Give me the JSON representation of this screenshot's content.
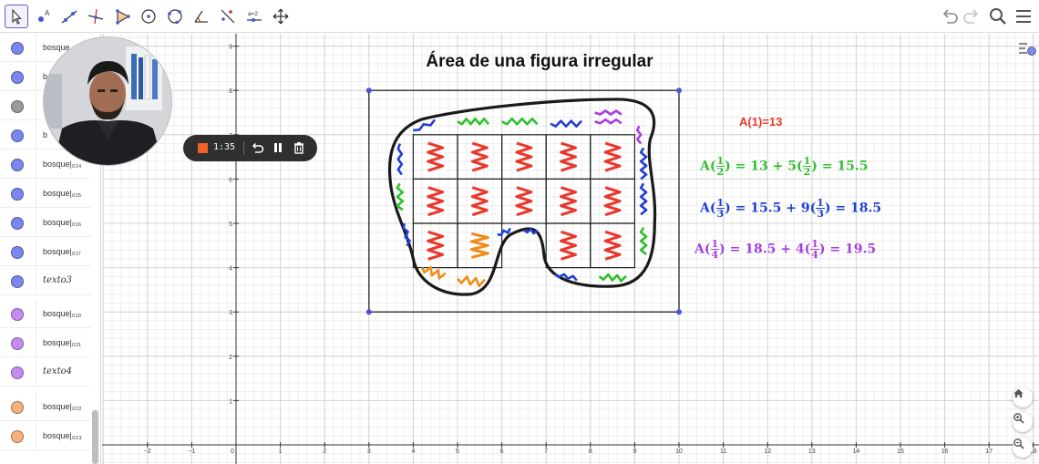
{
  "toolbar": {
    "tools": [
      "move-tool",
      "point-tool",
      "line-tool",
      "perpendicular-tool",
      "polygon-tool",
      "circle-tool",
      "circle-three-points-tool",
      "angle-tool",
      "reflect-tool",
      "slider-tool",
      "move-view-tool"
    ],
    "slider_tool_label": "a=2",
    "right": [
      "undo",
      "redo",
      "search",
      "menu"
    ]
  },
  "algebra": {
    "rows": [
      {
        "label": "bosque",
        "color": "#7b87f0",
        "type": "object"
      },
      {
        "label": "b",
        "color": "#7b87f0",
        "type": "object"
      },
      {
        "label": "",
        "color": "#9b9b9b",
        "type": "object"
      },
      {
        "label": "b",
        "color": "#7b87f0",
        "type": "object"
      },
      {
        "label": "bosque|₀₁₄",
        "color": "#7b87f0",
        "type": "object"
      },
      {
        "label": "bosque|₀₁₅",
        "color": "#7b87f0",
        "type": "object"
      },
      {
        "label": "bosque|₀₁₆",
        "color": "#7b87f0",
        "type": "object"
      },
      {
        "label": "bosque|₀₁₇",
        "color": "#7b87f0",
        "type": "object"
      },
      {
        "label": "texto3",
        "color": "#7b87f0",
        "type": "text"
      },
      {
        "label": "bosque|₀₁₉",
        "color": "#c58bf0",
        "type": "object"
      },
      {
        "label": "bosque|₀₂₁",
        "color": "#c58bf0",
        "type": "object"
      },
      {
        "label": "texto4",
        "color": "#c58bf0",
        "type": "text"
      },
      {
        "label": "bosque|₀₂₂",
        "color": "#f6b27a",
        "type": "object"
      },
      {
        "label": "bosque|₀₂₃",
        "color": "#f6b27a",
        "type": "object"
      }
    ]
  },
  "recorder": {
    "time": "1:35"
  },
  "graphics": {
    "title": "Área de una figura irregular",
    "area_label": "A(1)=13",
    "formulas": [
      {
        "lhs_prefix": "A(",
        "num": "1",
        "den": "2",
        "mid": ") = 13 + 5(",
        "num2": "1",
        "den2": "2",
        "end": ") = 15.5",
        "color": "#2fbf2f"
      },
      {
        "lhs_prefix": "A(",
        "num": "1",
        "den": "3",
        "mid": ") = 15.5 + 9(",
        "num2": "1",
        "den2": "3",
        "end": ") = 18.5",
        "color": "#1f3fd6"
      },
      {
        "lhs_prefix": "A(",
        "num": "1",
        "den": "4",
        "mid": ") = 18.5 + 4(",
        "num2": "1",
        "den2": "4",
        "end": ") = 19.5",
        "color": "#a53fe0"
      }
    ],
    "x_ticks": [
      "−2",
      "−1",
      "0",
      "1",
      "2",
      "3",
      "4",
      "5",
      "6",
      "7",
      "8",
      "9",
      "10",
      "11",
      "12",
      "13",
      "14",
      "15",
      "16",
      "17",
      "18"
    ],
    "y_ticks": [
      "1",
      "2",
      "3",
      "4",
      "5",
      "6",
      "7",
      "8",
      "9"
    ],
    "colors": {
      "accent": "#6557d2",
      "red": "#e8382b",
      "green": "#2fbf2f",
      "blue": "#1f3fd6",
      "purple": "#a53fe0",
      "orange": "#f08c1a",
      "point": "#4a55d6"
    }
  }
}
